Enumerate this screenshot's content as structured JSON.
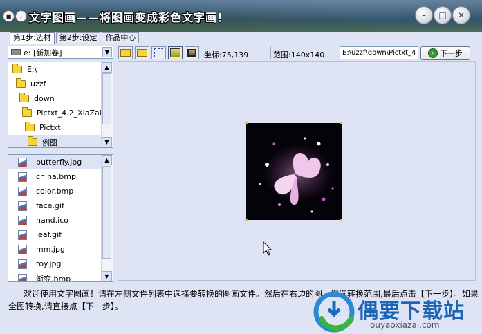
{
  "window": {
    "title": "文字图画——将图画变成彩色文字画！"
  },
  "tabs": [
    {
      "label": "第1步:选材"
    },
    {
      "label": "第2步:设定"
    },
    {
      "label": "作品中心"
    }
  ],
  "drive": {
    "label": "e: [新加卷]"
  },
  "folders": [
    {
      "label": "E:\\"
    },
    {
      "label": "uzzf"
    },
    {
      "label": "down"
    },
    {
      "label": "Pictxt_4.2_XiaZaiBa"
    },
    {
      "label": "Pictxt"
    },
    {
      "label": "例图"
    }
  ],
  "files": [
    {
      "label": "butterfly.jpg"
    },
    {
      "label": "china.bmp"
    },
    {
      "label": "color.bmp"
    },
    {
      "label": "face.gif"
    },
    {
      "label": "hand.ico"
    },
    {
      "label": "leaf.gif"
    },
    {
      "label": "mm.jpg"
    },
    {
      "label": "toy.jpg"
    },
    {
      "label": "渐变.bmp"
    }
  ],
  "toolbar": {
    "coord_label": "坐标:75,139",
    "range_label": "范围:140x140",
    "path_value": "E:\\uzzf\\down\\Pictxt_4",
    "next_label": "下一步"
  },
  "description": "欢迎使用文字图画！请在左侧文件列表中选择要转换的图画文件。然后在右边的图上框选转换范围,最后点击【下一步】。如果全图转换,请直接点【下一步】。",
  "watermark": {
    "brand": "偶要下载站",
    "url": "ouyaoxiazai.com"
  }
}
